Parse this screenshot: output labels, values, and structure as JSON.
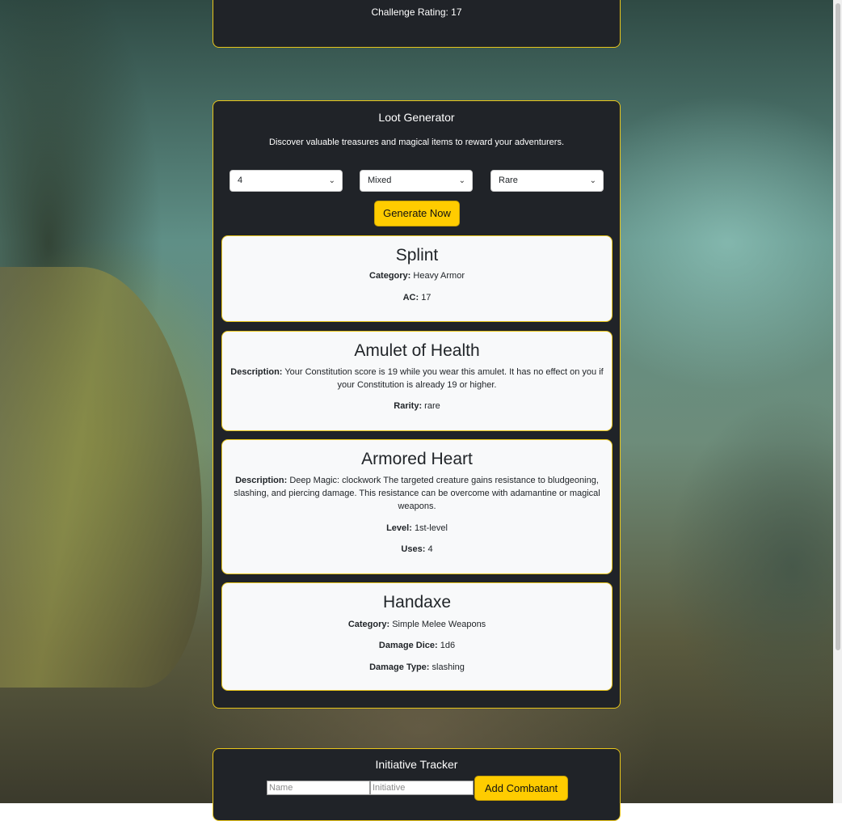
{
  "colors": {
    "panel_bg": "#202328",
    "accent_border": "#e8c51a",
    "button": "#ffcc00",
    "card_bg": "#f8f9fa"
  },
  "monster_panel": {
    "challenge_rating": "Challenge Rating: 17"
  },
  "loot": {
    "title": "Loot Generator",
    "description": "Discover valuable treasures and magical items to reward your adventurers.",
    "selects": {
      "count": "4",
      "type": "Mixed",
      "rarity": "Rare"
    },
    "generate_label": "Generate Now",
    "items": [
      {
        "name": "Splint",
        "lines": [
          {
            "label": "Category:",
            "value": "Heavy Armor"
          },
          {
            "label": "AC:",
            "value": "17"
          }
        ]
      },
      {
        "name": "Amulet of Health",
        "lines": [
          {
            "label": "Description:",
            "value": "Your Constitution score is 19 while you wear this amulet. It has no effect on you if your Constitution is already 19 or higher."
          },
          {
            "label": "Rarity:",
            "value": "rare"
          }
        ]
      },
      {
        "name": "Armored Heart",
        "lines": [
          {
            "label": "Description:",
            "value": "Deep Magic: clockwork The targeted creature gains resistance to bludgeoning, slashing, and piercing damage. This resistance can be overcome with adamantine or magical weapons."
          },
          {
            "label": "Level:",
            "value": "1st-level"
          },
          {
            "label": "Uses:",
            "value": "4"
          }
        ]
      },
      {
        "name": "Handaxe",
        "lines": [
          {
            "label": "Category:",
            "value": "Simple Melee Weapons"
          },
          {
            "label": "Damage Dice:",
            "value": "1d6"
          },
          {
            "label": "Damage Type:",
            "value": "slashing"
          }
        ]
      }
    ]
  },
  "initiative": {
    "title": "Initiative Tracker",
    "name_placeholder": "Name",
    "initiative_placeholder": "Initiative",
    "add_label": "Add Combatant"
  }
}
